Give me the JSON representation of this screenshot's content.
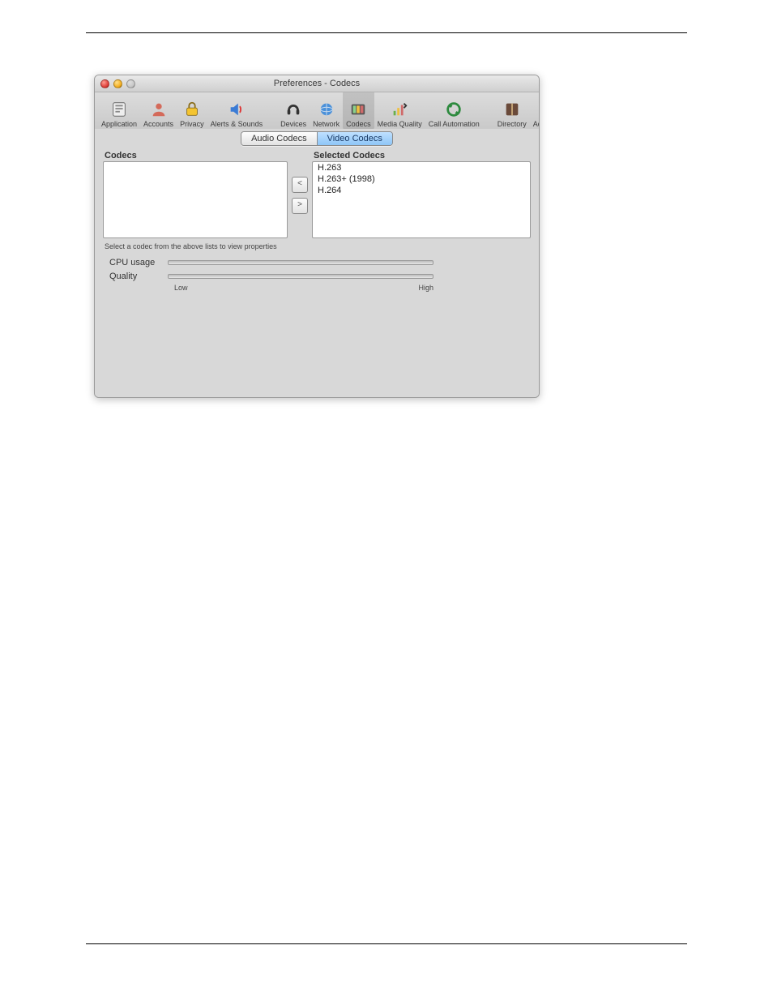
{
  "window": {
    "title": "Preferences - Codecs"
  },
  "toolbar": {
    "items": [
      {
        "id": "application",
        "label": "Application"
      },
      {
        "id": "accounts",
        "label": "Accounts"
      },
      {
        "id": "privacy",
        "label": "Privacy"
      },
      {
        "id": "alerts",
        "label": "Alerts & Sounds"
      },
      {
        "id": "devices",
        "label": "Devices"
      },
      {
        "id": "network",
        "label": "Network"
      },
      {
        "id": "codecs",
        "label": "Codecs"
      },
      {
        "id": "mediaquality",
        "label": "Media Quality"
      },
      {
        "id": "callauto",
        "label": "Call Automation"
      },
      {
        "id": "directory",
        "label": "Directory"
      },
      {
        "id": "advanced",
        "label": "Advanced"
      }
    ],
    "selected": "codecs"
  },
  "tabs": {
    "audio": "Audio Codecs",
    "video": "Video Codecs",
    "active": "video"
  },
  "codecs": {
    "available_header": "Codecs",
    "selected_header": "Selected Codecs",
    "available": [],
    "selected": [
      "H.263",
      "H.263+ (1998)",
      "H.264"
    ],
    "move_left_label": "<",
    "move_right_label": ">"
  },
  "properties": {
    "hint": "Select a codec from the above lists to view properties",
    "cpu_label": "CPU usage",
    "quality_label": "Quality",
    "low": "Low",
    "high": "High"
  }
}
